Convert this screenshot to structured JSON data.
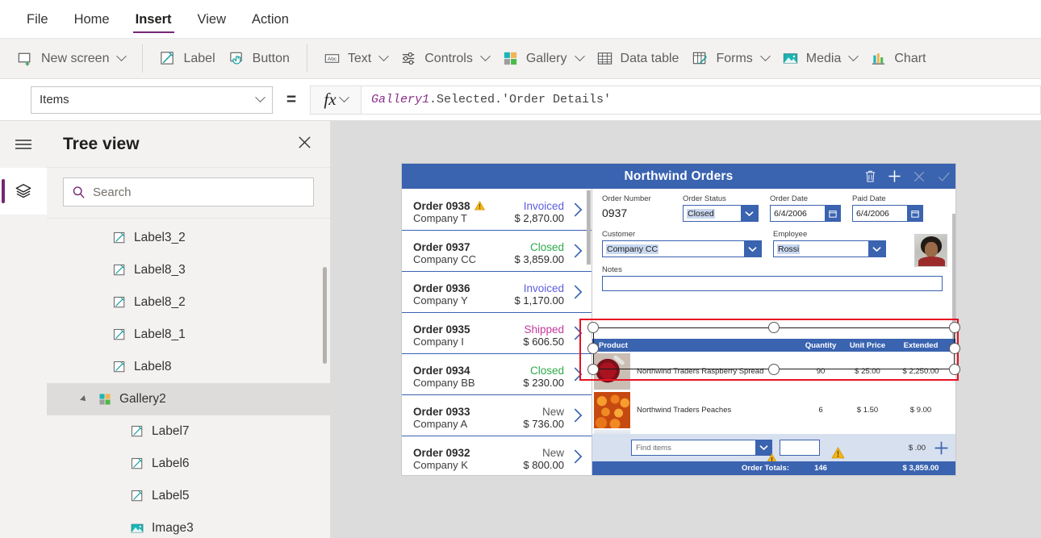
{
  "menu": {
    "items": [
      {
        "label": "File",
        "active": false
      },
      {
        "label": "Home",
        "active": false
      },
      {
        "label": "Insert",
        "active": true
      },
      {
        "label": "View",
        "active": false
      },
      {
        "label": "Action",
        "active": false
      }
    ]
  },
  "ribbon": {
    "groups": [
      {
        "items": [
          {
            "label": "New screen",
            "icon": "new-screen-icon",
            "caret": true
          }
        ]
      },
      {
        "items": [
          {
            "label": "Label",
            "icon": "label-icon",
            "caret": false
          },
          {
            "label": "Button",
            "icon": "button-icon",
            "caret": false
          }
        ]
      },
      {
        "items": [
          {
            "label": "Text",
            "icon": "text-icon",
            "caret": true
          },
          {
            "label": "Controls",
            "icon": "controls-icon",
            "caret": true
          },
          {
            "label": "Gallery",
            "icon": "gallery-icon",
            "caret": true
          },
          {
            "label": "Data table",
            "icon": "data-table-icon",
            "caret": false
          },
          {
            "label": "Forms",
            "icon": "forms-icon",
            "caret": true
          },
          {
            "label": "Media",
            "icon": "media-icon",
            "caret": true
          },
          {
            "label": "Chart",
            "icon": "chart-icon",
            "caret": false
          }
        ]
      }
    ]
  },
  "formula_bar": {
    "property": "Items",
    "equals": "=",
    "fx_label": "fx",
    "formula_identifier": "Gallery1",
    "formula_rest": ".Selected.'Order Details'"
  },
  "tree_panel": {
    "title": "Tree view",
    "search_placeholder": "Search",
    "search_value": "",
    "nodes": [
      {
        "label": "Label3_2",
        "icon": "label-icon",
        "indent": 2,
        "expander": false,
        "selected": false
      },
      {
        "label": "Label8_3",
        "icon": "label-icon",
        "indent": 2,
        "expander": false,
        "selected": false
      },
      {
        "label": "Label8_2",
        "icon": "label-icon",
        "indent": 2,
        "expander": false,
        "selected": false
      },
      {
        "label": "Label8_1",
        "icon": "label-icon",
        "indent": 2,
        "expander": false,
        "selected": false
      },
      {
        "label": "Label8",
        "icon": "label-icon",
        "indent": 2,
        "expander": false,
        "selected": false
      },
      {
        "label": "Gallery2",
        "icon": "gallery-icon",
        "indent": 1,
        "expander": true,
        "selected": true
      },
      {
        "label": "Label7",
        "icon": "label-icon",
        "indent": 3,
        "expander": false,
        "selected": false
      },
      {
        "label": "Label6",
        "icon": "label-icon",
        "indent": 3,
        "expander": false,
        "selected": false
      },
      {
        "label": "Label5",
        "icon": "label-icon",
        "indent": 3,
        "expander": false,
        "selected": false
      },
      {
        "label": "Image3",
        "icon": "image-icon",
        "indent": 3,
        "expander": false,
        "selected": false
      }
    ]
  },
  "app": {
    "title": "Northwind Orders",
    "header_actions": [
      {
        "name": "delete-icon",
        "enabled": true
      },
      {
        "name": "add-icon",
        "enabled": true
      },
      {
        "name": "cancel-icon",
        "enabled": false
      },
      {
        "name": "confirm-icon",
        "enabled": false
      }
    ],
    "orders": [
      {
        "id": "Order 0938",
        "company": "Company T",
        "status": "Invoiced",
        "amount": "$ 2,870.00",
        "warning": true
      },
      {
        "id": "Order 0937",
        "company": "Company CC",
        "status": "Closed",
        "amount": "$ 3,859.00",
        "warning": false
      },
      {
        "id": "Order 0936",
        "company": "Company Y",
        "status": "Invoiced",
        "amount": "$ 1,170.00",
        "warning": false
      },
      {
        "id": "Order 0935",
        "company": "Company I",
        "status": "Shipped",
        "amount": "$ 606.50",
        "warning": false
      },
      {
        "id": "Order 0934",
        "company": "Company BB",
        "status": "Closed",
        "amount": "$ 230.00",
        "warning": false
      },
      {
        "id": "Order 0933",
        "company": "Company A",
        "status": "New",
        "amount": "$ 736.00",
        "warning": false
      },
      {
        "id": "Order 0932",
        "company": "Company K",
        "status": "New",
        "amount": "$ 800.00",
        "warning": false
      }
    ],
    "form": {
      "order_number_label": "Order Number",
      "order_number_value": "0937",
      "order_status_label": "Order Status",
      "order_status_value": "Closed",
      "order_date_label": "Order Date",
      "order_date_value": "6/4/2006",
      "paid_date_label": "Paid Date",
      "paid_date_value": "6/4/2006",
      "customer_label": "Customer",
      "customer_value": "Company CC",
      "employee_label": "Employee",
      "employee_value": "Rossi",
      "notes_label": "Notes",
      "notes_value": ""
    },
    "products": {
      "headers": {
        "product": "Product",
        "quantity": "Quantity",
        "unit_price": "Unit Price",
        "extended": "Extended"
      },
      "rows": [
        {
          "name": "Northwind Traders Raspberry Spread",
          "qty": "90",
          "unit_price": "$ 25.00",
          "extended": "$ 2,250.00",
          "thumb": "raspberry-spread-thumb"
        },
        {
          "name": "Northwind Traders Peaches",
          "qty": "6",
          "unit_price": "$ 1.50",
          "extended": "$ 9.00",
          "thumb": "peaches-thumb"
        },
        {
          "name": "",
          "qty": "",
          "unit_price": "",
          "extended": "",
          "thumb": "boxed-product-thumb"
        }
      ],
      "add_row": {
        "find_placeholder": "Find items",
        "qty_value": "",
        "price": "$ .00",
        "add_icon": "plus-icon",
        "warnings": 2
      },
      "totals": {
        "label": "Order Totals:",
        "quantity": "146",
        "amount": "$ 3,859.00"
      }
    }
  },
  "colors": {
    "accent_purple": "#742774",
    "app_blue": "#3a63b0",
    "selection_red": "#e81123",
    "status_invoiced": "#5c5ce0",
    "status_closed": "#2eaa4a",
    "status_shipped": "#c5399d",
    "status_new": "#595959",
    "warning_yellow": "#f2b51a"
  }
}
